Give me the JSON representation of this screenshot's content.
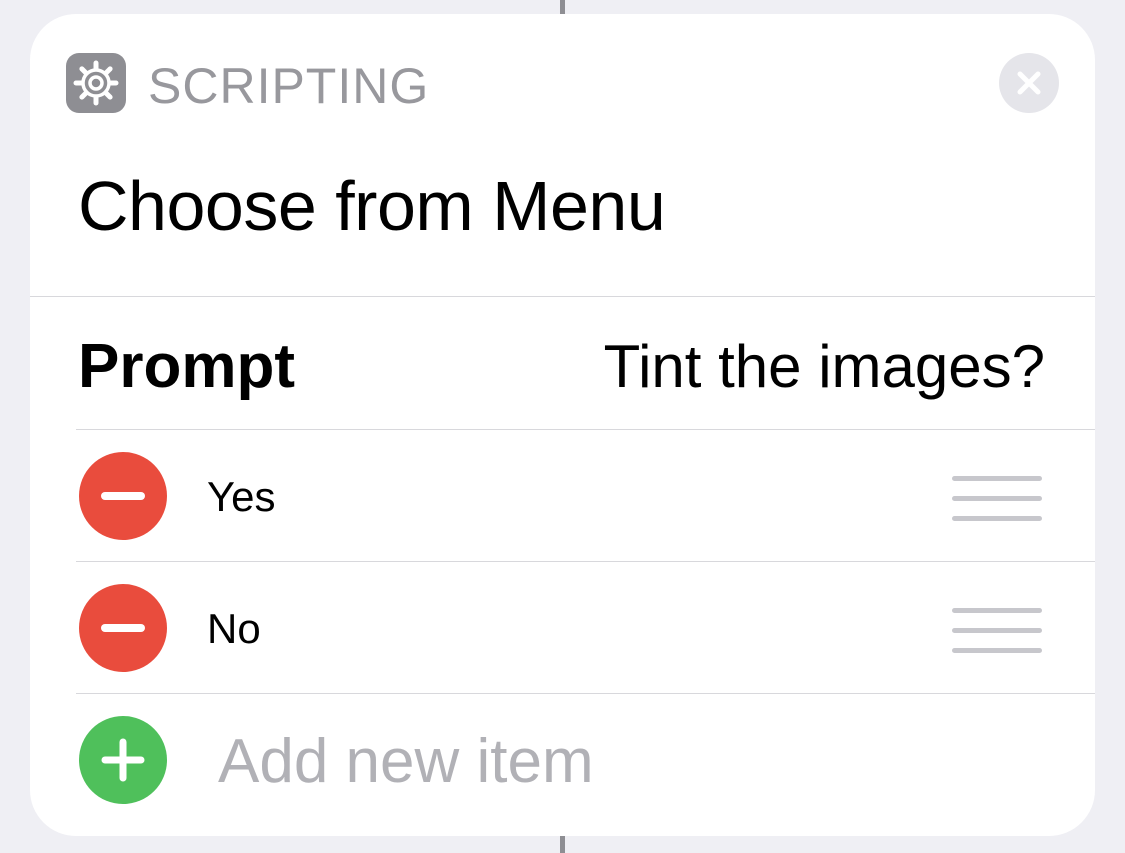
{
  "header": {
    "category_icon": "gear-icon",
    "category_label": "SCRIPTING",
    "close_icon": "close-icon"
  },
  "action": {
    "title": "Choose from Menu"
  },
  "prompt": {
    "label": "Prompt",
    "value": "Tint the images?"
  },
  "menu_items": [
    {
      "label": "Yes",
      "remove_icon": "minus-icon",
      "reorder_icon": "drag-handle-icon"
    },
    {
      "label": "No",
      "remove_icon": "minus-icon",
      "reorder_icon": "drag-handle-icon"
    }
  ],
  "add_item": {
    "placeholder": "Add new item",
    "icon": "plus-icon"
  },
  "colors": {
    "remove": "#e94c3d",
    "add": "#4fc05b",
    "secondary_text": "#98989d",
    "placeholder_text": "#b1b1b6"
  }
}
